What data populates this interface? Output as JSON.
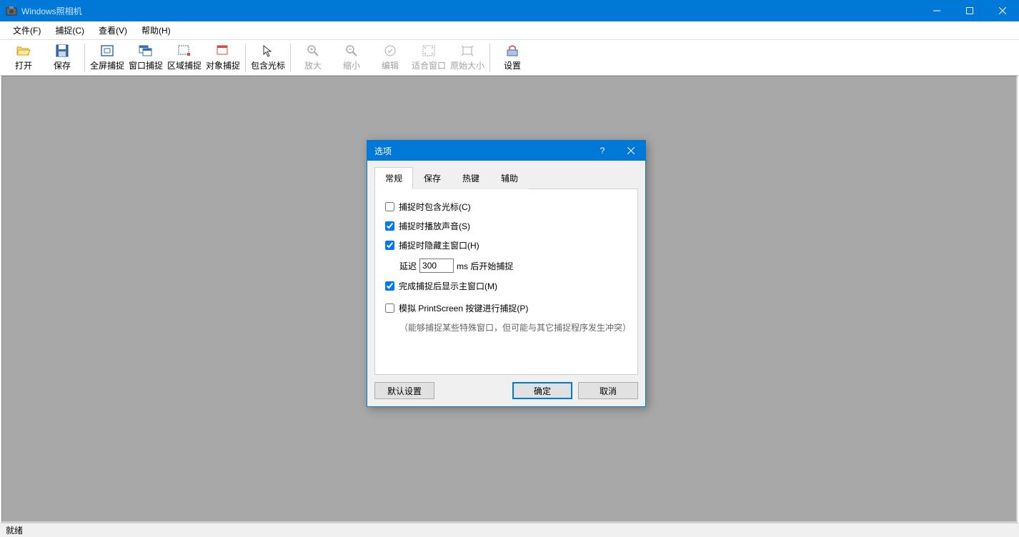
{
  "app": {
    "title": "Windows照相机"
  },
  "menubar": {
    "file": "文件(F)",
    "capture": "捕捉(C)",
    "view": "查看(V)",
    "help": "帮助(H)"
  },
  "toolbar": {
    "open": "打开",
    "save": "保存",
    "fullscreen_capture": "全屏捕捉",
    "window_capture": "窗口捕捉",
    "region_capture": "区域捕捉",
    "object_capture": "对象捕捉",
    "include_cursor": "包含光标",
    "zoom_in": "放大",
    "zoom_out": "缩小",
    "edit": "编辑",
    "fit_window": "适合窗口",
    "original_size": "原始大小",
    "settings": "设置"
  },
  "statusbar": {
    "text": "就绪"
  },
  "dialog": {
    "title": "选项",
    "tabs": {
      "general": "常规",
      "save": "保存",
      "hotkey": "热键",
      "assist": "辅助"
    },
    "options": {
      "include_cursor": "捕捉时包含光标(C)",
      "play_sound": "捕捉时播放声音(S)",
      "hide_main_window": "捕捉时隐藏主窗口(H)",
      "delay_prefix": "延迟",
      "delay_value": "300",
      "delay_suffix": "ms 后开始捕捉",
      "show_after_capture": "完成捕捉后显示主窗口(M)",
      "simulate_printscreen": "模拟 PrintScreen 按键进行捕捉(P)",
      "printscreen_note": "（能够捕捉某些特殊窗口，但可能与其它捕捉程序发生冲突）"
    },
    "buttons": {
      "default": "默认设置",
      "ok": "确定",
      "cancel": "取消"
    }
  }
}
